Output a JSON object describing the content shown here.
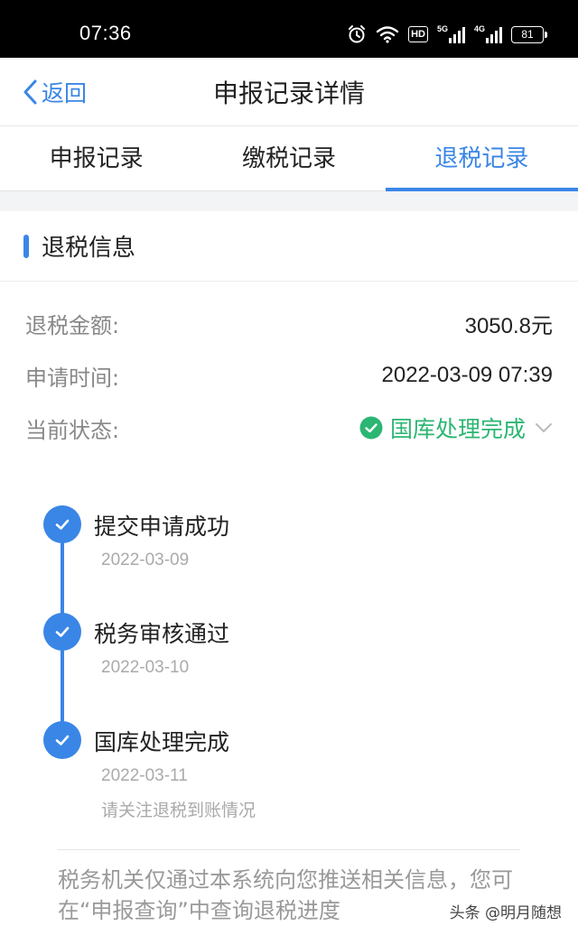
{
  "status_bar": {
    "time": "07:36",
    "hd": "HD",
    "net_5g": "5G",
    "net_4g": "4G",
    "battery": "81"
  },
  "nav": {
    "back_label": "返回",
    "title": "申报记录详情"
  },
  "tabs": [
    {
      "label": "申报记录"
    },
    {
      "label": "缴税记录"
    },
    {
      "label": "退税记录"
    }
  ],
  "active_tab": 2,
  "section": {
    "title": "退税信息"
  },
  "info": {
    "amount_label": "退税金额:",
    "amount_value": "3050.8元",
    "time_label": "申请时间:",
    "time_value": "2022-03-09 07:39",
    "status_label": "当前状态:",
    "status_value": "国库处理完成"
  },
  "timeline": [
    {
      "title": "提交申请成功",
      "date": "2022-03-09"
    },
    {
      "title": "税务审核通过",
      "date": "2022-03-10"
    },
    {
      "title": "国库处理完成",
      "date": "2022-03-11",
      "note": "请关注退税到账情况"
    }
  ],
  "footer_note": "税务机关仅通过本系统向您推送相关信息，您可在“申报查询”中查询退税进度",
  "watermark": "头条 @明月随想",
  "colors": {
    "accent": "#3a86e6",
    "success": "#2bb673",
    "muted": "#888888"
  },
  "icons": [
    "alarm-icon",
    "wifi-icon",
    "signal-icon",
    "battery-icon",
    "chevron-left-icon",
    "check-circle-icon",
    "chevron-down-icon",
    "check-icon"
  ]
}
